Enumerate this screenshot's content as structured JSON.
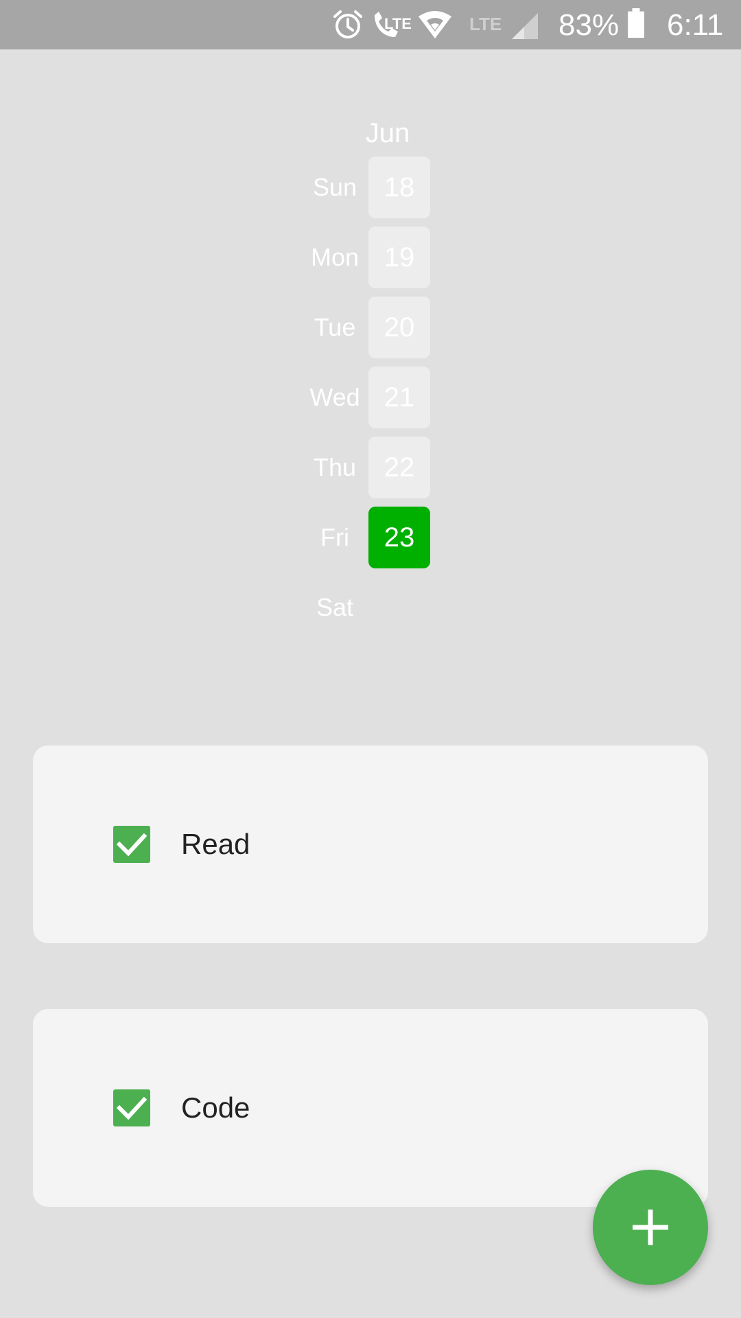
{
  "status_bar": {
    "battery": "83%",
    "time": "6:11",
    "icons": [
      "alarm-icon",
      "volte-call-icon",
      "wifi-icon",
      "lte-signal-icon",
      "battery-icon"
    ],
    "lte_label_1": "LTE",
    "lte_label_2": "LTE"
  },
  "calendar": {
    "month": "Jun",
    "days": [
      {
        "name": "Sun",
        "date": "18"
      },
      {
        "name": "Mon",
        "date": "19"
      },
      {
        "name": "Tue",
        "date": "20"
      },
      {
        "name": "Wed",
        "date": "21"
      },
      {
        "name": "Thu",
        "date": "22"
      },
      {
        "name": "Fri",
        "date": "23"
      },
      {
        "name": "Sat",
        "date": ""
      }
    ],
    "selected_date": "23",
    "accent_color": "#00b000"
  },
  "tasks": [
    {
      "label": "Read",
      "checked": true
    },
    {
      "label": "Code",
      "checked": true
    }
  ],
  "fab": {
    "icon": "plus-icon",
    "color": "#4caf50"
  }
}
